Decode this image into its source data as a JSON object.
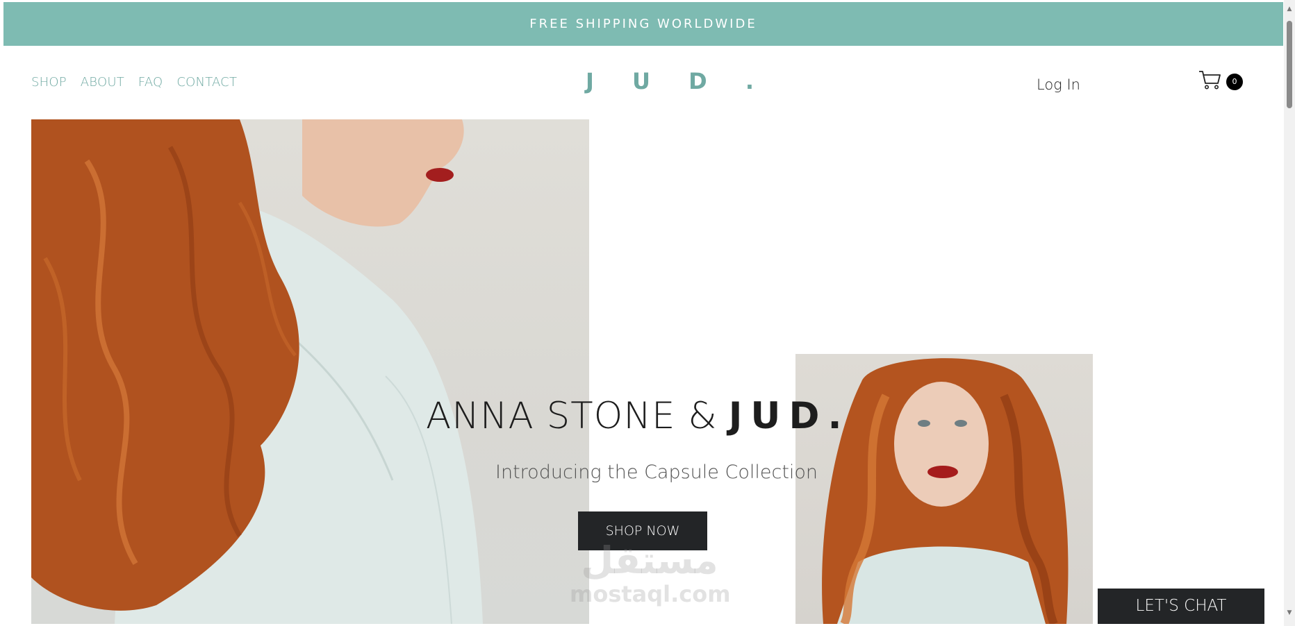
{
  "promo": {
    "text": "FREE SHIPPING WORLDWIDE"
  },
  "nav": {
    "items": [
      "SHOP",
      "ABOUT",
      "FAQ",
      "CONTACT"
    ]
  },
  "brand": {
    "logo": "J U D ."
  },
  "account": {
    "login_label": "Log In"
  },
  "cart": {
    "count": "0",
    "icon": "cart-icon"
  },
  "hero": {
    "headline_prefix": "ANNA STONE &",
    "headline_brand": "JUD.",
    "subtitle": "Introducing the Capsule Collection",
    "cta": "SHOP NOW"
  },
  "watermark": {
    "arabic": "مستقل",
    "latin": "mostaql.com"
  },
  "chat": {
    "label": "LET'S CHAT"
  },
  "colors": {
    "accent": "#7ebbb2",
    "nav_text": "#6fa9a2",
    "dark_button": "#232527"
  }
}
